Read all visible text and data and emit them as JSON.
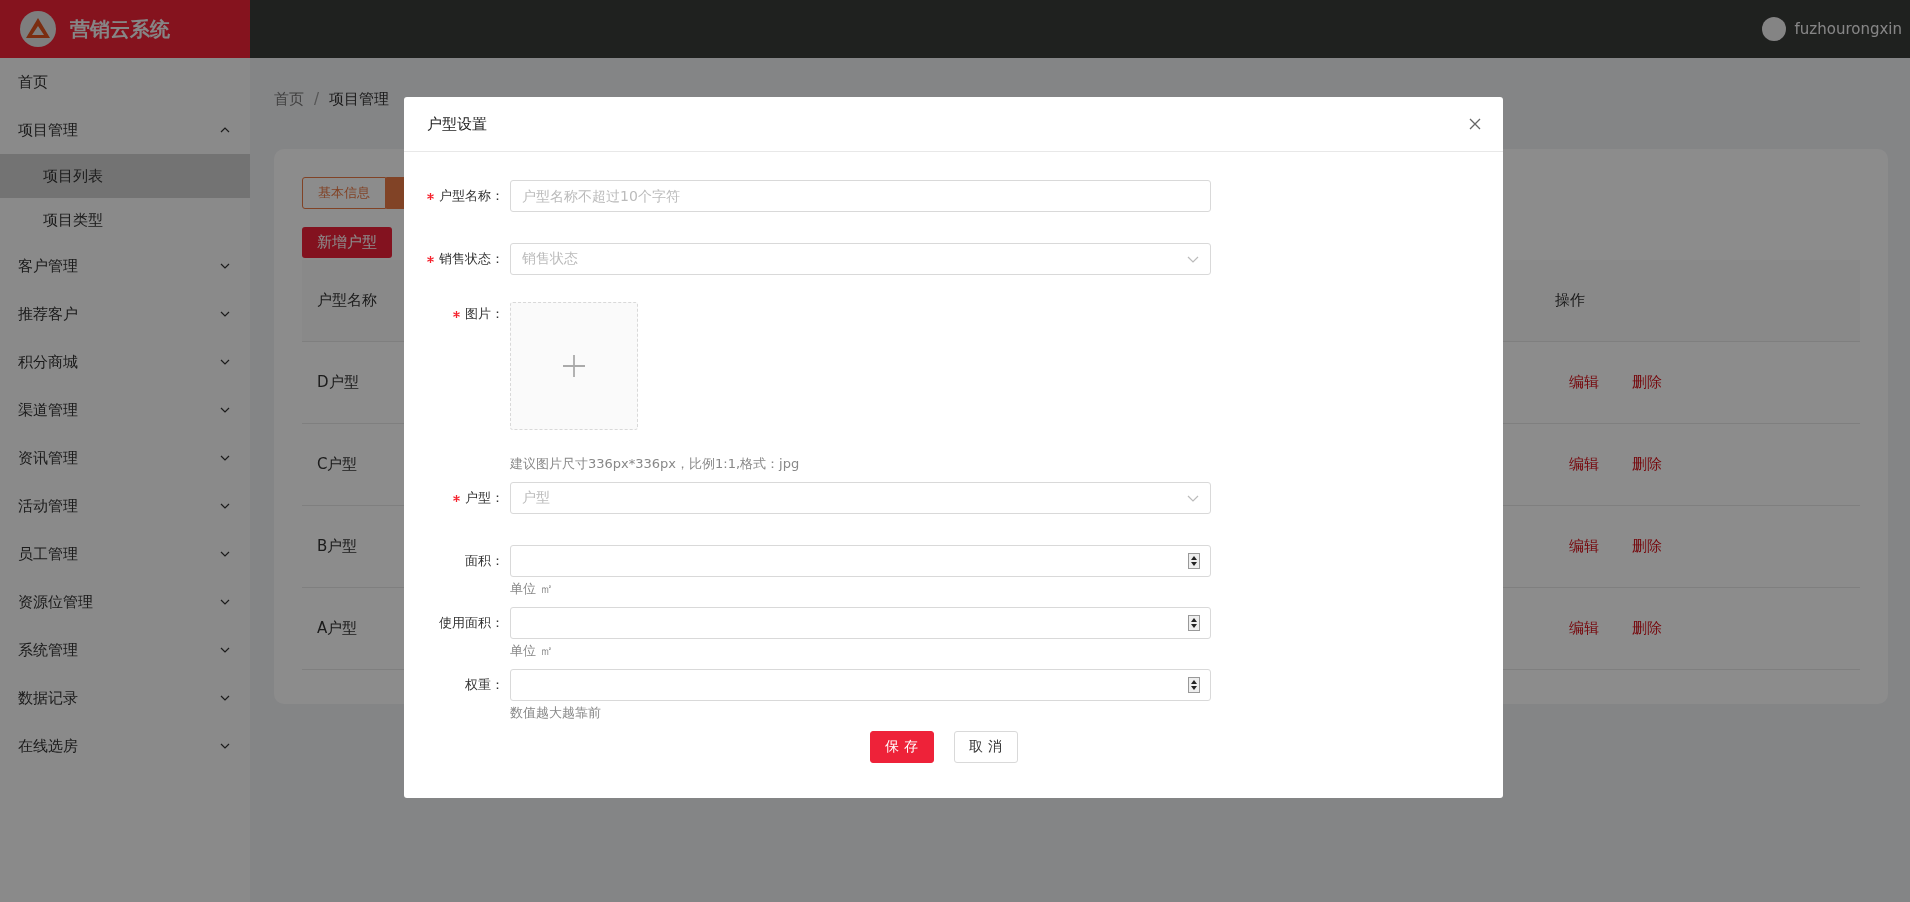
{
  "app": {
    "title": "营销云系统",
    "user": "fuzhourongxin"
  },
  "sidebar": {
    "items": [
      {
        "label": "首页",
        "selected": false
      },
      {
        "label": "项目管理",
        "selected": false,
        "expanded": true,
        "children": [
          {
            "label": "项目列表",
            "selected": true
          },
          {
            "label": "项目类型",
            "selected": false
          }
        ]
      },
      {
        "label": "客户管理",
        "selected": false,
        "expanded": false
      },
      {
        "label": "推荐客户",
        "selected": false,
        "expanded": false
      },
      {
        "label": "积分商城",
        "selected": false,
        "expanded": false
      },
      {
        "label": "渠道管理",
        "selected": false,
        "expanded": false
      },
      {
        "label": "资讯管理",
        "selected": false,
        "expanded": false
      },
      {
        "label": "活动管理",
        "selected": false,
        "expanded": false
      },
      {
        "label": "员工管理",
        "selected": false,
        "expanded": false
      },
      {
        "label": "资源位管理",
        "selected": false,
        "expanded": false
      },
      {
        "label": "系统管理",
        "selected": false,
        "expanded": false
      },
      {
        "label": "数据记录",
        "selected": false,
        "expanded": false
      },
      {
        "label": "在线选房",
        "selected": false,
        "expanded": false
      }
    ]
  },
  "breadcrumb": {
    "items": [
      "首页",
      "项目管理"
    ],
    "separator": "/"
  },
  "tabs": [
    {
      "label": "基本信息",
      "selected": false
    },
    {
      "selected": true
    }
  ],
  "add_button": "新增户型",
  "table": {
    "columns": [
      "户型名称",
      "操作"
    ],
    "rows": [
      {
        "name": "D户型",
        "actions": [
          "编辑",
          "删除"
        ]
      },
      {
        "name": "C户型",
        "actions": [
          "编辑",
          "删除"
        ]
      },
      {
        "name": "B户型",
        "actions": [
          "编辑",
          "删除"
        ]
      },
      {
        "name": "A户型",
        "actions": [
          "编辑",
          "删除"
        ]
      }
    ]
  },
  "dialog": {
    "title": "户型设置",
    "fields": [
      {
        "kind": "text",
        "label": "户型名称：",
        "required": true,
        "placeholder": "户型名称不超过10个字符"
      },
      {
        "kind": "select",
        "label": "销售状态：",
        "required": true,
        "placeholder": "销售状态"
      },
      {
        "kind": "upload",
        "label": "图片：",
        "required": true,
        "hint": "建议图片尺寸336px*336px，比例1:1,格式：jpg"
      },
      {
        "kind": "select",
        "label": "户型：",
        "required": true,
        "placeholder": "户型"
      },
      {
        "kind": "number",
        "label": "面积：",
        "required": false,
        "hint": "单位 ㎡"
      },
      {
        "kind": "number",
        "label": "使用面积：",
        "required": false,
        "hint": "单位 ㎡"
      },
      {
        "kind": "number",
        "label": "权重：",
        "required": false,
        "hint": "数值越大越靠前"
      }
    ],
    "buttons": [
      {
        "label": "保 存",
        "kind": "primary"
      },
      {
        "label": "取 消",
        "kind": "default"
      }
    ]
  }
}
